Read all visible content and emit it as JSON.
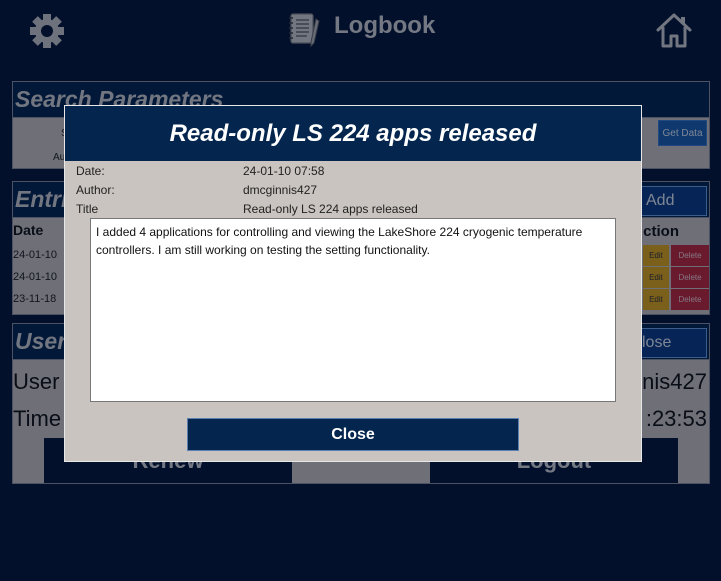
{
  "header": {
    "title": "Logbook",
    "settings_icon": "gear-icon",
    "logbook_icon": "notebook-pen-icon",
    "home_icon": "home-icon"
  },
  "search": {
    "heading": "Search Parameters",
    "label_s": "S",
    "label_au": "Au",
    "get_data_label": "Get Data"
  },
  "entries": {
    "heading": "Entri",
    "add_label": "Add",
    "col_date": "Date",
    "col_action": "ction",
    "rows": [
      {
        "date": "24-01-10",
        "edit": "Edit",
        "delete": "Delete"
      },
      {
        "date": "24-01-10",
        "edit": "Edit",
        "delete": "Delete"
      },
      {
        "date": "23-11-18",
        "edit": "Edit",
        "delete": "Delete"
      }
    ]
  },
  "user": {
    "heading": "User",
    "close_label": "lose",
    "user_label": "User",
    "user_value": "nis427",
    "time_label": "Time",
    "time_value": ":23:53",
    "renew_label": "Renew",
    "logout_label": "Logout"
  },
  "modal": {
    "title": "Read-only LS 224 apps released",
    "date_label": "Date:",
    "date_value": "24-01-10 07:58",
    "author_label": "Author:",
    "author_value": "dmcginnis427",
    "title_label": "Title",
    "title_value": "Read-only LS 224 apps released",
    "body": "I added 4 applications for controlling and viewing the LakeShore 224 cryogenic temperature controllers. I am still working on testing the setting functionality.",
    "close_label": "Close"
  },
  "colors": {
    "background": "#041637",
    "header_blue": "#03254e",
    "panel": "#c9c4bf",
    "edit": "#e0a818",
    "delete": "#c2283a",
    "accent": "#1a5fb0"
  }
}
